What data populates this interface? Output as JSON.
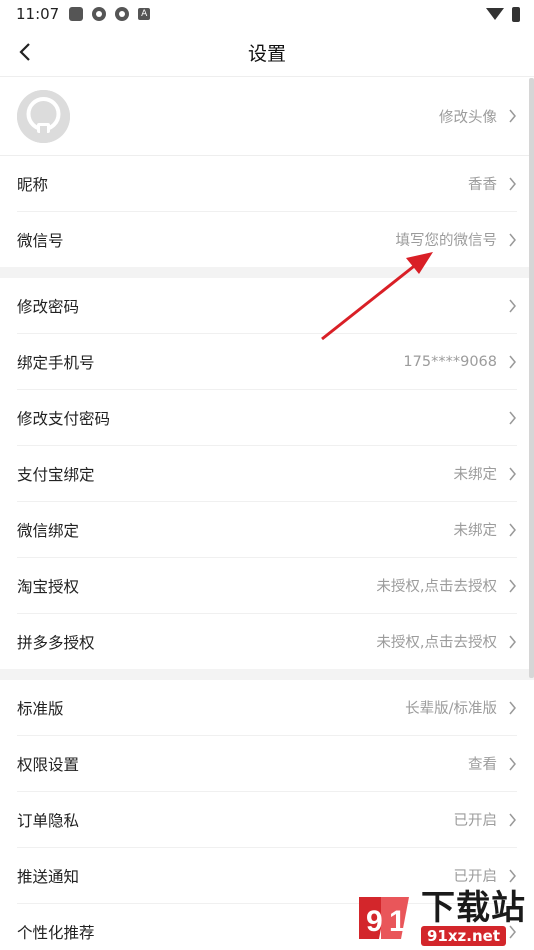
{
  "status_bar": {
    "time": "11:07",
    "badge": "A"
  },
  "header": {
    "title": "设置"
  },
  "avatar_row": {
    "value": "修改头像"
  },
  "group1": [
    {
      "label": "昵称",
      "value": "香香"
    },
    {
      "label": "微信号",
      "value": "填写您的微信号"
    }
  ],
  "group2": [
    {
      "label": "修改密码",
      "value": ""
    },
    {
      "label": "绑定手机号",
      "value": "175****9068"
    },
    {
      "label": "修改支付密码",
      "value": ""
    },
    {
      "label": "支付宝绑定",
      "value": "未绑定"
    },
    {
      "label": "微信绑定",
      "value": "未绑定"
    },
    {
      "label": "淘宝授权",
      "value": "未授权,点击去授权"
    },
    {
      "label": "拼多多授权",
      "value": "未授权,点击去授权"
    }
  ],
  "group3": [
    {
      "label": "标准版",
      "value": "长辈版/标准版"
    },
    {
      "label": "权限设置",
      "value": "查看"
    },
    {
      "label": "订单隐私",
      "value": "已开启"
    },
    {
      "label": "推送通知",
      "value": "已开启"
    },
    {
      "label": "个性化推荐",
      "value": ""
    }
  ],
  "watermark": {
    "brand_cn": "下载站",
    "url": "91xz.net"
  },
  "colors": {
    "accent_arrow": "#d91f26",
    "value_text": "#9c9c9c",
    "separator": "#f3f3f3"
  }
}
